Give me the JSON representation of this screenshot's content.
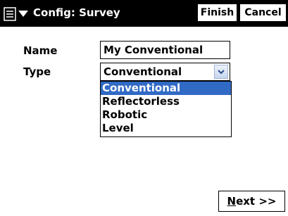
{
  "titlebar": {
    "title": "Config: Survey",
    "finish_label": "Finish",
    "cancel_label": "Cancel"
  },
  "form": {
    "name_label": "Name",
    "name_value": "My Conventional",
    "type_label": "Type",
    "type_value": "Conventional",
    "type_options": [
      "Conventional",
      "Reflectorless",
      "Robotic",
      "Level"
    ],
    "selected_index": 0
  },
  "footer": {
    "next_mnemonic": "N",
    "next_rest": "ext >>"
  },
  "colors": {
    "titlebar_bg": "#000000",
    "selection_bg": "#316ac5",
    "selection_fg": "#ffffff"
  }
}
